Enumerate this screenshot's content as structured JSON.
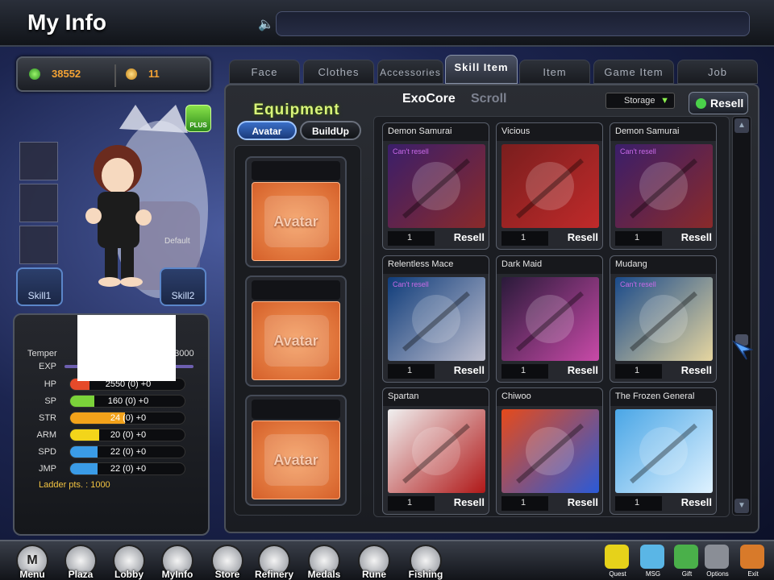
{
  "header": {
    "title": "My Info"
  },
  "currency": {
    "gold": "38552",
    "gem": "11"
  },
  "character": {
    "plus_label": "PLUS",
    "default_label": "Default",
    "skill1": "Skill1",
    "skill2": "Skill2"
  },
  "stats": {
    "temper_label": "Temper",
    "temper_value": "93000",
    "exp_label": "EXP",
    "rows": [
      {
        "label": "HP",
        "value": "2550 (0) +0",
        "fill": 0.17,
        "color": "#e64a2a"
      },
      {
        "label": "SP",
        "value": "160 (0) +0",
        "fill": 0.21,
        "color": "#7bd23a"
      },
      {
        "label": "STR",
        "value": "24 (0) +0",
        "fill": 0.48,
        "color": "#f3a21a"
      },
      {
        "label": "ARM",
        "value": "20 (0) +0",
        "fill": 0.25,
        "color": "#f3d51a"
      },
      {
        "label": "SPD",
        "value": "22 (0) +0",
        "fill": 0.24,
        "color": "#3a9be6"
      },
      {
        "label": "JMP",
        "value": "22 (0) +0",
        "fill": 0.24,
        "color": "#3a9be6"
      }
    ],
    "ladder": "Ladder pts. : 1000"
  },
  "tabs": [
    "Face",
    "Clothes",
    "Accessories",
    "Skill Item",
    "Item",
    "Game Item",
    "Job"
  ],
  "active_tab": "Skill Item",
  "equipment": {
    "title": "Equipment",
    "btn_avatar": "Avatar",
    "btn_buildup": "BuildUp",
    "slots": [
      "Avatar",
      "Avatar",
      "Avatar"
    ]
  },
  "subtabs": {
    "exocore": "ExoCore",
    "scroll": "Scroll"
  },
  "storage": {
    "selected": "Storage"
  },
  "resell_label": "Resell",
  "cant_resell": "Can't resell",
  "items": [
    {
      "name": "Demon Samurai",
      "qty": "1",
      "cant_resell": true,
      "art": "Demon Samurai"
    },
    {
      "name": "Vicious",
      "qty": "1",
      "cant_resell": false,
      "art": "VICIOUS"
    },
    {
      "name": "Demon Samurai",
      "qty": "1",
      "cant_resell": true,
      "art": "Demon Samurai"
    },
    {
      "name": "Relentless Mace",
      "qty": "1",
      "cant_resell": true,
      "art": "Relentless Mace"
    },
    {
      "name": "Dark Maid",
      "qty": "1",
      "cant_resell": false,
      "art": "Dark Maid"
    },
    {
      "name": "Mudang",
      "qty": "1",
      "cant_resell": true,
      "art": "Mudang"
    },
    {
      "name": "Spartan",
      "qty": "1",
      "cant_resell": false,
      "art": "Spartan"
    },
    {
      "name": "Chiwoo",
      "qty": "1",
      "cant_resell": false,
      "art": "Chiwoo"
    },
    {
      "name": "The Frozen General",
      "qty": "1",
      "cant_resell": false,
      "art": "The Frozen General"
    }
  ],
  "bottom_nav": [
    "Menu",
    "Plaza",
    "Lobby",
    "MyInfo",
    "Store",
    "Refinery",
    "Medals",
    "Rune",
    "Fishing"
  ],
  "bottom_right": [
    "Quest",
    "MSG",
    "Gift",
    "Options",
    "Exit"
  ]
}
